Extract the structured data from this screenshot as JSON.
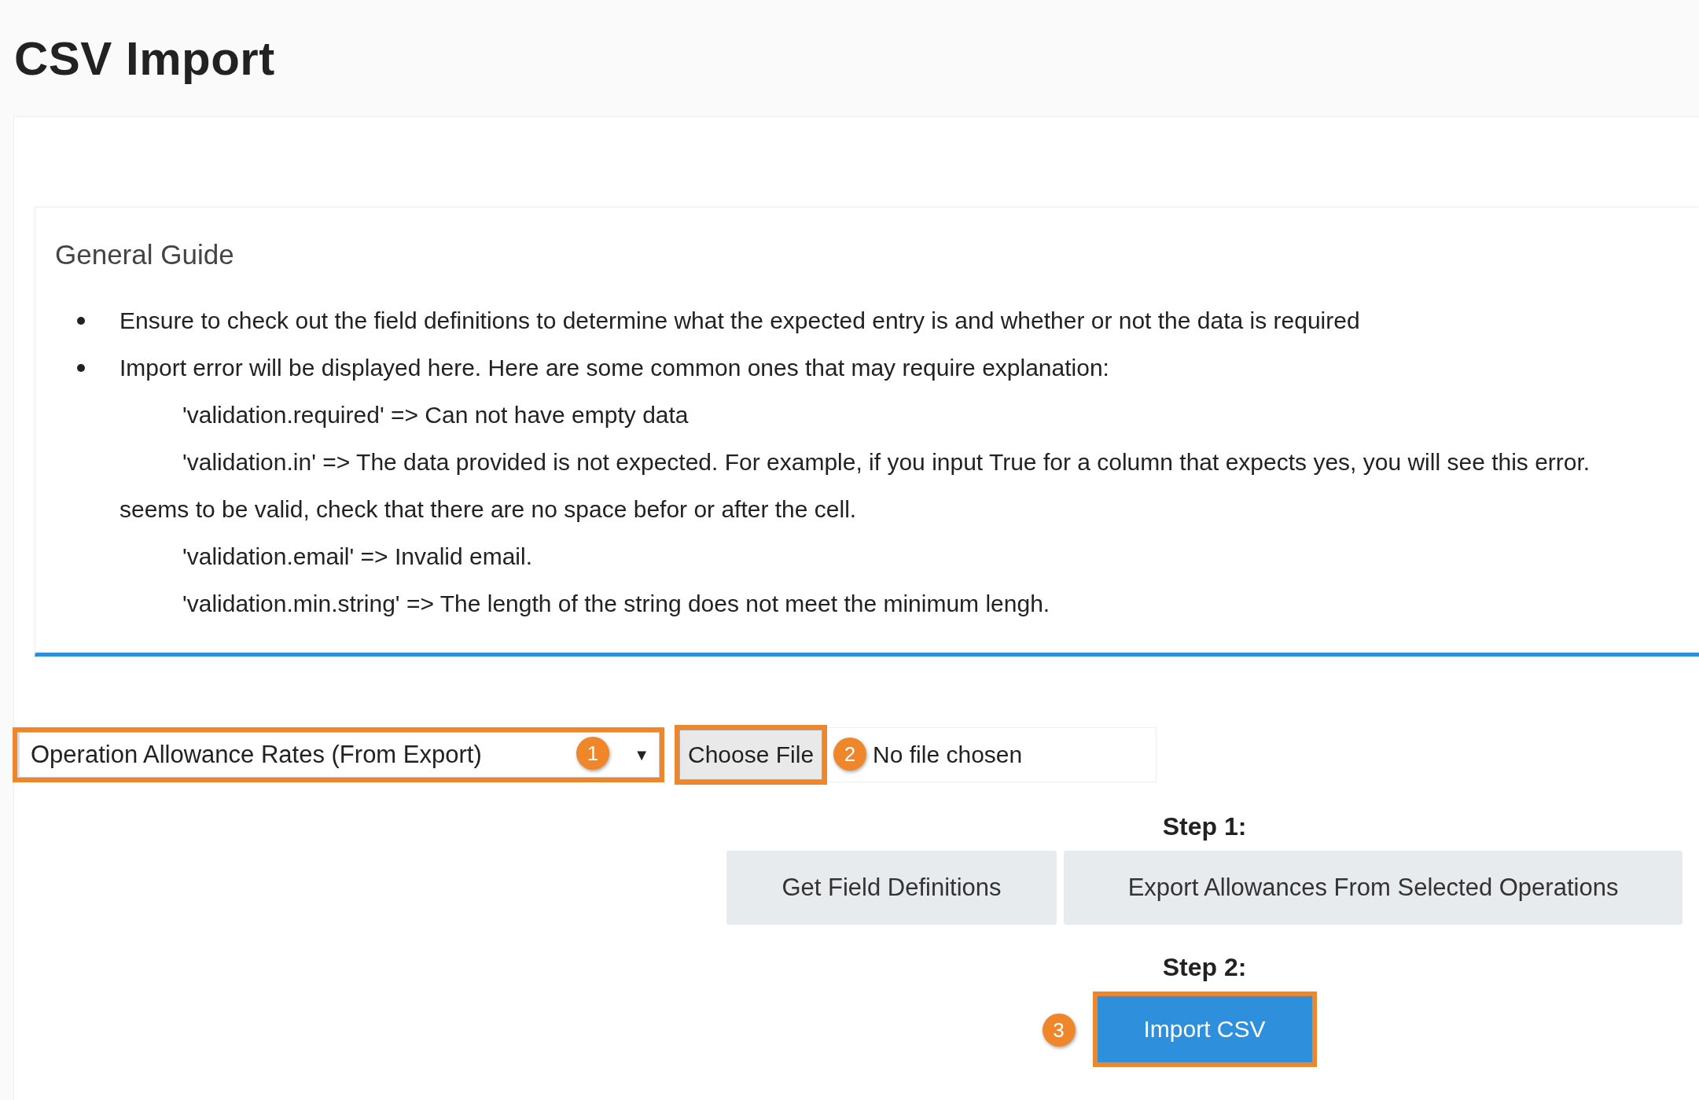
{
  "page": {
    "title": "CSV Import"
  },
  "guide": {
    "title": "General Guide",
    "lines": [
      {
        "kind": "bullet",
        "text": "Ensure to check out the field definitions to determine what the expected entry is and whether or not the data is required"
      },
      {
        "kind": "bullet",
        "text": "Import error will be displayed here. Here are some common ones that may require explanation:"
      },
      {
        "kind": "indented",
        "text": "'validation.required' => Can not have empty data"
      },
      {
        "kind": "indented",
        "text": "'validation.in' => The data provided is not expected. For example, if you input True for a column that expects yes, you will see this error."
      },
      {
        "kind": "continued",
        "text": "seems to be valid, check that there are no space befor or after the cell."
      },
      {
        "kind": "indented",
        "text": "'validation.email' => Invalid email."
      },
      {
        "kind": "indented",
        "text": "'validation.min.string' => The length of the string does not meet the minimum lengh."
      }
    ]
  },
  "import_form": {
    "type_select": {
      "value": "Operation Allowance Rates (From Export)",
      "arrow": "▼",
      "highlighted": true,
      "marker": "1"
    },
    "file_input": {
      "button": "Choose File",
      "status": "No file chosen",
      "highlighted": true,
      "marker": "2"
    },
    "step1": {
      "label": "Step 1:",
      "buttons": [
        "Get Field Definitions",
        "Export Allowances From Selected Operations"
      ]
    },
    "step2": {
      "label": "Step 2:",
      "button": "Import CSV",
      "highlighted": true,
      "marker": "3"
    }
  }
}
